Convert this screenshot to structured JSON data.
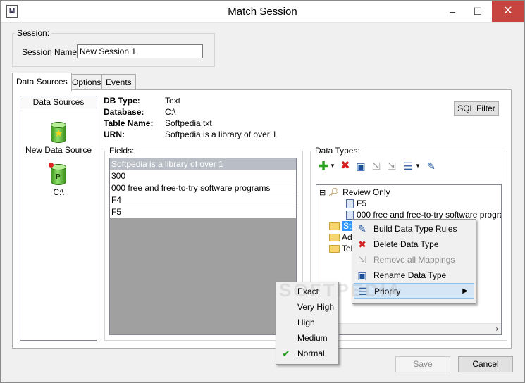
{
  "window": {
    "title": "Match Session",
    "app_icon": "M",
    "minimize_glyph": "–",
    "maximize_glyph": "☐",
    "close_glyph": "✕"
  },
  "session": {
    "group_label": "Session:",
    "name_label": "Session Name:",
    "name_value": "New Session 1"
  },
  "tabs": [
    "Data Sources",
    "Options",
    "Events"
  ],
  "data_sources": {
    "header": "Data Sources",
    "items": [
      {
        "label": "New Data Source",
        "icon": "database-star-icon"
      },
      {
        "label": "C:\\",
        "icon": "database-p-icon"
      }
    ]
  },
  "info": {
    "db_type_label": "DB Type:",
    "db_type_value": "Text",
    "database_label": "Database:",
    "database_value": "C:\\",
    "table_name_label": "Table Name:",
    "table_name_value": "Softpedia.txt",
    "urn_label": "URN:",
    "urn_value": "Softpedia is a library of over 1"
  },
  "sql_filter_label": "SQL Filter",
  "fields": {
    "label": "Fields:",
    "rows": [
      "Softpedia is a library of over 1",
      "300",
      "000 free and free-to-try software programs",
      "F4",
      "F5"
    ]
  },
  "data_types": {
    "label": "Data Types:",
    "toolbar_icons": [
      "add-icon",
      "dropdown-arrow-icon",
      "delete-icon",
      "map-icon",
      "unmap-icon",
      "unmap-all-icon",
      "list-icon",
      "dropdown-arrow-icon",
      "build-rules-icon"
    ],
    "tree": {
      "review_toggle": "⊟",
      "review_label": "Review Only",
      "child1": "F5",
      "child2": "000 free and free-to-try software program",
      "folder1": "Str",
      "folder2": "Ad",
      "folder3": "Tel"
    }
  },
  "context_menu": {
    "items": [
      {
        "label": "Build Data Type Rules",
        "icon": "build-rules-icon"
      },
      {
        "label": "Delete Data Type",
        "icon": "delete-icon"
      },
      {
        "label": "Remove all Mappings",
        "icon": "unmap-icon"
      },
      {
        "label": "Rename Data Type",
        "icon": "rename-icon"
      },
      {
        "label": "Priority",
        "icon": "priority-icon"
      }
    ],
    "submenu_arrow": "▶"
  },
  "priority_menu": {
    "items": [
      "Exact",
      "Very High",
      "High",
      "Medium",
      "Normal"
    ],
    "checked": "Normal",
    "check_glyph": "✔"
  },
  "buttons": {
    "save": "Save",
    "cancel": "Cancel"
  },
  "watermark": "SOFTPEDIA",
  "colors": {
    "menu_highlight": "#d5e6f7",
    "selected_row": "#b8bdc6",
    "close_button": "#c7443f"
  }
}
